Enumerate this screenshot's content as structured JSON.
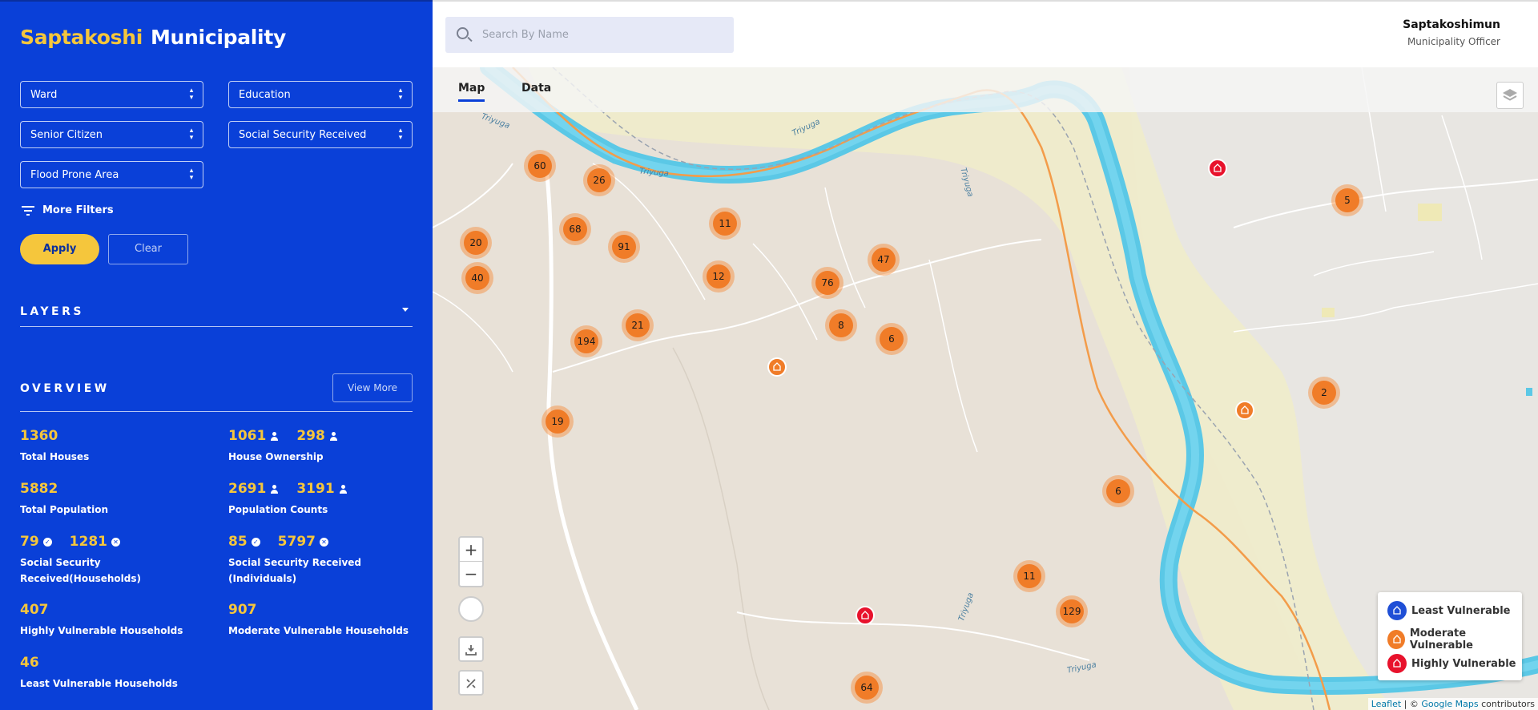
{
  "brand": {
    "name_accent": "Saptakoshi",
    "name_main": "Municipality"
  },
  "filters": {
    "ward": "Ward",
    "education": "Education",
    "senior_citizen": "Senior Citizen",
    "social_security": "Social Security Received",
    "flood_prone": "Flood Prone Area",
    "more_filters": "More Filters",
    "apply": "Apply",
    "clear": "Clear"
  },
  "layers": {
    "title": "LAYERS"
  },
  "overview": {
    "title": "OVERVIEW",
    "view_more": "View More",
    "total_houses": {
      "value": "1360",
      "label": "Total Houses"
    },
    "house_ownership": {
      "value_a": "1061",
      "value_b": "298",
      "label": "House Ownership"
    },
    "total_population": {
      "value": "5882",
      "label": "Total Population"
    },
    "population_counts": {
      "value_a": "2691",
      "value_b": "3191",
      "label": "Population Counts"
    },
    "ss_households": {
      "value_yes": "79",
      "value_no": "1281",
      "label_line1": "Social Security",
      "label_line2": "Received(Households)"
    },
    "ss_individuals": {
      "value_yes": "85",
      "value_no": "5797",
      "label_line1": "Social Security Received",
      "label_line2": "(Individuals)"
    },
    "highly_vulnerable": {
      "value": "407",
      "label": "Highly Vulnerable Households"
    },
    "moderate_vulnerable": {
      "value": "907",
      "label": "Moderate Vulnerable Households"
    },
    "least_vulnerable": {
      "value": "46",
      "label": "Least Vulnerable Households"
    }
  },
  "search": {
    "placeholder": "Search By Name"
  },
  "user": {
    "name": "Saptakoshimun",
    "role": "Municipality Officer"
  },
  "map": {
    "tabs": [
      "Map",
      "Data"
    ],
    "active_tab": "Map",
    "river_label": "Triyuga",
    "clusters": [
      "60",
      "26",
      "68",
      "91",
      "11",
      "20",
      "40",
      "12",
      "76",
      "47",
      "21",
      "8",
      "6",
      "194",
      "19",
      "6",
      "11",
      "129",
      "64",
      "5",
      "2"
    ],
    "zoom_in": "+",
    "zoom_out": "−",
    "legend": {
      "least": "Least Vulnerable",
      "moderate": "Moderate Vulnerable",
      "highly": "Highly Vulnerable"
    },
    "legend_colors": {
      "least": "#1f4fd6",
      "moderate": "#f07c28",
      "highly": "#e8122c"
    },
    "attribution": {
      "leaflet": "Leaflet",
      "sep": " | © ",
      "google": "Google Maps",
      "suffix": " contributors"
    }
  }
}
